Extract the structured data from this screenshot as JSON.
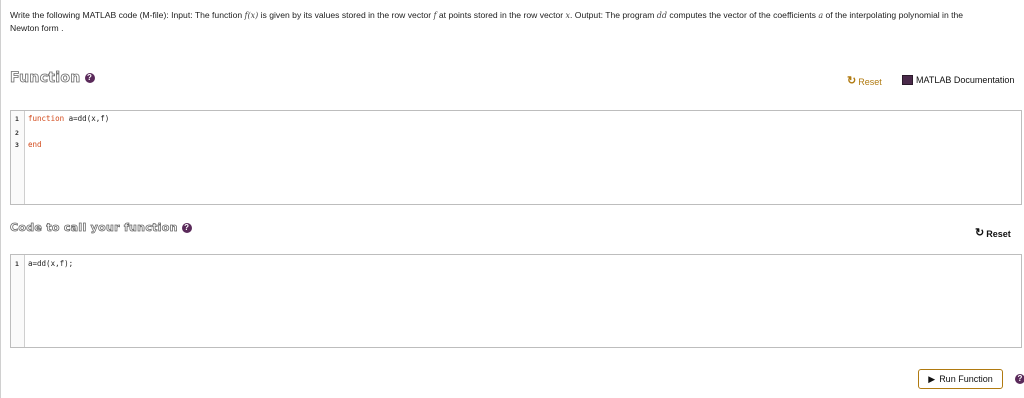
{
  "problem": {
    "text_1": "Write the following MATLAB code (M-file): Input: The function ",
    "math_fx": "f(x)",
    "text_2": " is given by its values stored in the row vector ",
    "math_f": "f",
    "text_3": " at points stored in the row vector ",
    "math_x": "x",
    "text_4": ". Output: The program ",
    "math_dd": "dd",
    "text_5": " computes the vector of the coefficients ",
    "math_a": "a",
    "text_6": " of the interpolating polynomial in the",
    "text_7": "Newton form ."
  },
  "function_section": {
    "title": "Function",
    "help_icon": "?",
    "reset_label": "Reset",
    "doc_label": "MATLAB Documentation",
    "lines": [
      {
        "num": "1",
        "keyword": "function",
        "rest": " a=dd(x,f)"
      },
      {
        "num": "2",
        "keyword": "",
        "rest": ""
      },
      {
        "num": "3",
        "keyword": "end",
        "rest": ""
      }
    ]
  },
  "call_section": {
    "title": "Code to call your function",
    "help_icon": "?",
    "reset_label": "Reset",
    "lines": [
      {
        "num": "1",
        "code": "a=dd(x,f);"
      }
    ]
  },
  "run": {
    "label": "Run Function",
    "help_icon": "?"
  },
  "colors": {
    "accent": "#b07a10",
    "help_icon": "#5a2a5a",
    "keyword": "#d2491a"
  },
  "icons": {
    "reset": "refresh-icon",
    "documentation": "book-icon",
    "run": "play-icon",
    "help": "help-icon"
  }
}
